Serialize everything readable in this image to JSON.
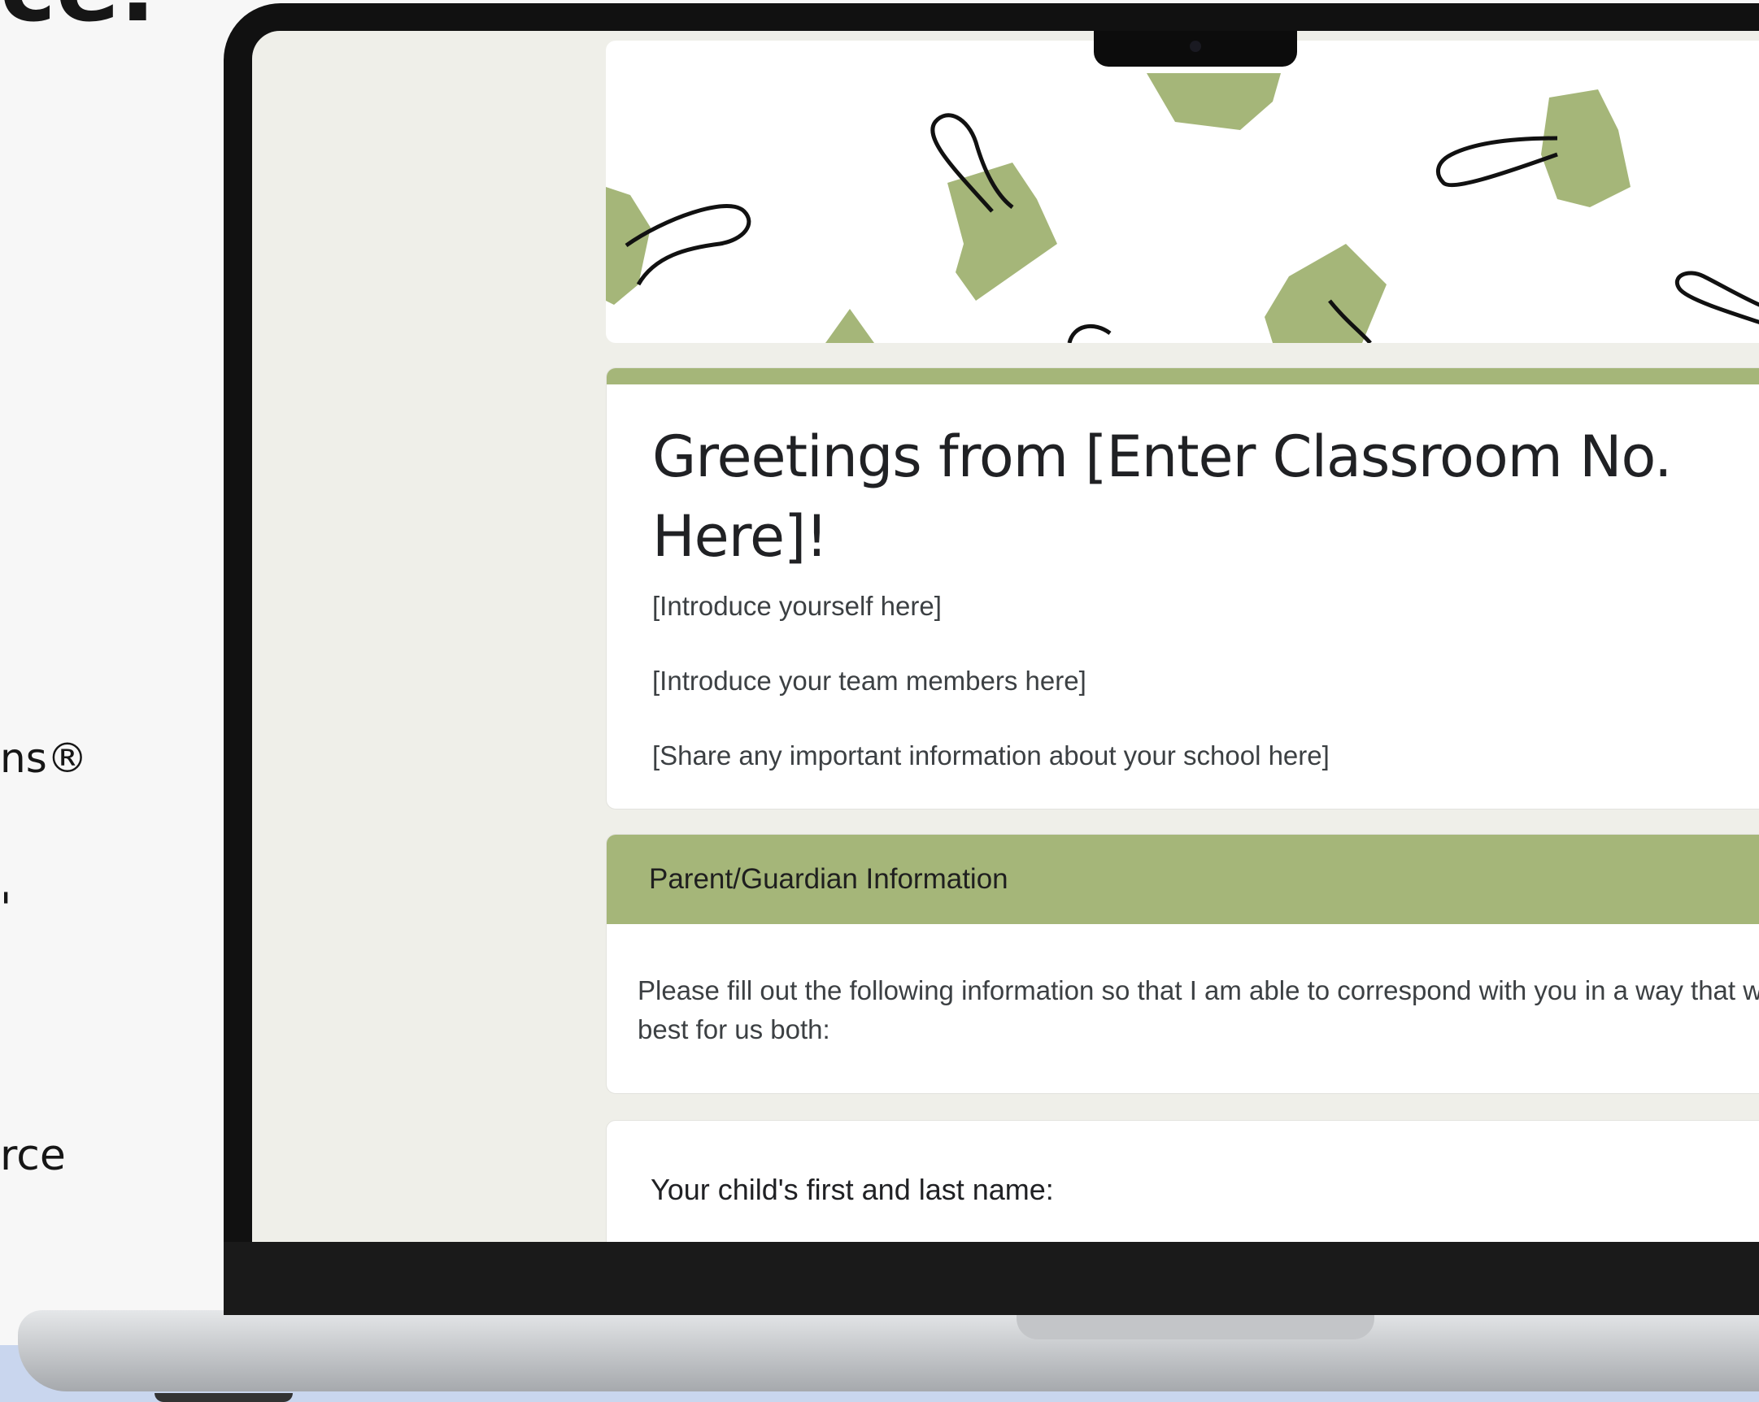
{
  "background_text": {
    "heading": "ce.",
    "line_1": "ns®",
    "line_2": "'",
    "line_3": "rce"
  },
  "form": {
    "title": "Greetings from [Enter Classroom No. Here]!",
    "description_lines": [
      "[Introduce yourself here]",
      "[Introduce your team members here]",
      "[Share any important information about your school here]"
    ],
    "section": {
      "title": "Parent/Guardian Information",
      "description": "Please fill out the following information so that I am able to correspond with you in a way that works best for us both:"
    },
    "question": {
      "label": "Your child's first and last name:"
    }
  },
  "colors": {
    "accent": "#a5b679",
    "screen_background": "#efefe9",
    "bezel": "#111111"
  },
  "header_image": {
    "description_icon": "binder-clip-icon"
  }
}
